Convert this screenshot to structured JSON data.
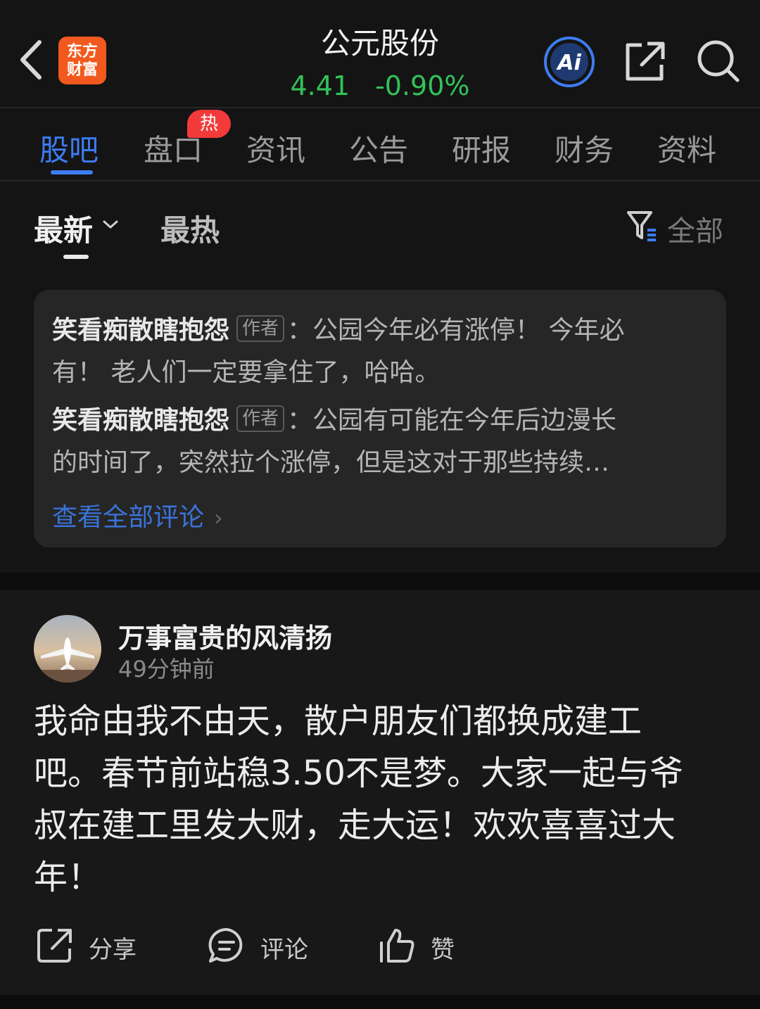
{
  "header": {
    "logo_line1": "东方",
    "logo_line2": "财富",
    "stock_name": "公元股份",
    "price": "4.41",
    "change": "-0.90%",
    "ai_label": "Ai",
    "colors": {
      "price_green": "#33c25a",
      "accent_blue": "#3d7cf2",
      "logo_orange": "#f2591e",
      "hot_red": "#f23a3a"
    }
  },
  "tabs": [
    {
      "label": "股吧",
      "active": true
    },
    {
      "label": "盘口",
      "badge": "热"
    },
    {
      "label": "资讯"
    },
    {
      "label": "公告"
    },
    {
      "label": "研报"
    },
    {
      "label": "财务"
    },
    {
      "label": "资料"
    }
  ],
  "sort": {
    "latest": "最新",
    "hot": "最热",
    "filter": "全部"
  },
  "comments_preview": {
    "items": [
      {
        "author": "笑看痴散瞎抱怨",
        "tag": "作者",
        "line1": "：公园今年必有涨停！ 今年必",
        "line2": "有！ 老人们一定要拿住了，哈哈。"
      },
      {
        "author": "笑看痴散瞎抱怨",
        "tag": "作者",
        "line1": "：公园有可能在今年后边漫长",
        "line2": "的时间了，突然拉个涨停，但是这对于那些持续…"
      }
    ],
    "see_all": "查看全部评论"
  },
  "post": {
    "username": "万事富贵的风清扬",
    "time": "49分钟前",
    "lines": [
      "我命由我不由天，散户朋友们都换成建工",
      "吧。春节前站稳3.50不是梦。大家一起与爷",
      "叔在建工里发大财，走大运！欢欢喜喜过大",
      "年！"
    ],
    "actions": {
      "share": "分享",
      "comment": "评论",
      "like": "赞"
    }
  }
}
